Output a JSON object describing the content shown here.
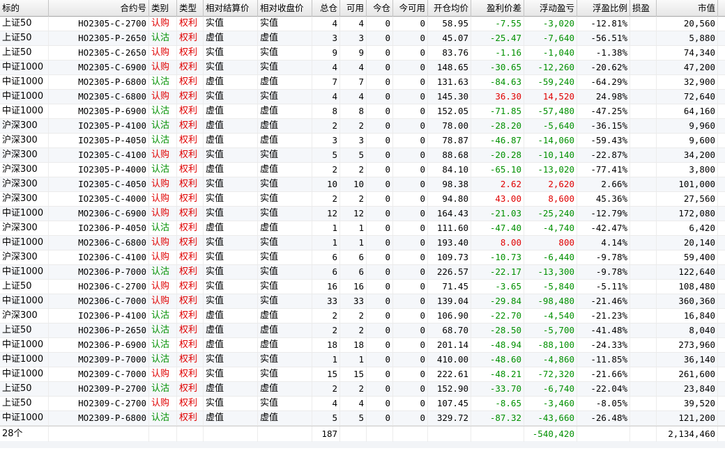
{
  "columns": [
    {
      "key": "underlying",
      "label": "标的",
      "w": 70,
      "align": "l"
    },
    {
      "key": "contract",
      "label": "合约号",
      "w": 144,
      "align": "r"
    },
    {
      "key": "category",
      "label": "类别",
      "w": 40,
      "align": "l"
    },
    {
      "key": "type",
      "label": "类型",
      "w": 38,
      "align": "l"
    },
    {
      "key": "settle",
      "label": "相对结算价",
      "w": 78,
      "align": "l"
    },
    {
      "key": "close",
      "label": "相对收盘价",
      "w": 78,
      "align": "l"
    },
    {
      "key": "total",
      "label": "总仓",
      "w": 40,
      "align": "r"
    },
    {
      "key": "avail",
      "label": "可用",
      "w": 38,
      "align": "r"
    },
    {
      "key": "today",
      "label": "今仓",
      "w": 38,
      "align": "r"
    },
    {
      "key": "today_avail",
      "label": "今可用",
      "w": 50,
      "align": "r"
    },
    {
      "key": "open_avg",
      "label": "开仓均价",
      "w": 62,
      "align": "r"
    },
    {
      "key": "pnl_diff",
      "label": "盈利价差",
      "w": 76,
      "align": "r"
    },
    {
      "key": "float_pnl",
      "label": "浮动盈亏",
      "w": 76,
      "align": "r"
    },
    {
      "key": "float_ratio",
      "label": "浮盈比例",
      "w": 76,
      "align": "r"
    },
    {
      "key": "stop",
      "label": "损盈",
      "w": 38,
      "align": "l"
    },
    {
      "key": "market_value",
      "label": "市值",
      "w": 88,
      "align": "r"
    }
  ],
  "colors": {
    "loss": "#009000",
    "profit": "#e00000",
    "call": "#e00000",
    "put": "#009000",
    "type": "#e00000"
  },
  "rows": [
    {
      "underlying": "上证50",
      "contract": "HO2305-C-2700",
      "category": "认购",
      "type": "权利",
      "settle": "实值",
      "close": "实值",
      "total": "4",
      "avail": "4",
      "today": "0",
      "today_avail": "0",
      "open_avg": "58.95",
      "pnl_diff": "-7.55",
      "float_pnl": "-3,020",
      "float_ratio": "-12.81%",
      "stop": "",
      "market_value": "20,560"
    },
    {
      "underlying": "上证50",
      "contract": "HO2305-P-2650",
      "category": "认沽",
      "type": "权利",
      "settle": "虚值",
      "close": "虚值",
      "total": "3",
      "avail": "3",
      "today": "0",
      "today_avail": "0",
      "open_avg": "45.07",
      "pnl_diff": "-25.47",
      "float_pnl": "-7,640",
      "float_ratio": "-56.51%",
      "stop": "",
      "market_value": "5,880"
    },
    {
      "underlying": "上证50",
      "contract": "HO2305-C-2650",
      "category": "认购",
      "type": "权利",
      "settle": "实值",
      "close": "实值",
      "total": "9",
      "avail": "9",
      "today": "0",
      "today_avail": "0",
      "open_avg": "83.76",
      "pnl_diff": "-1.16",
      "float_pnl": "-1,040",
      "float_ratio": "-1.38%",
      "stop": "",
      "market_value": "74,340"
    },
    {
      "underlying": "中证1000",
      "contract": "MO2305-C-6900",
      "category": "认购",
      "type": "权利",
      "settle": "实值",
      "close": "实值",
      "total": "4",
      "avail": "4",
      "today": "0",
      "today_avail": "0",
      "open_avg": "148.65",
      "pnl_diff": "-30.65",
      "float_pnl": "-12,260",
      "float_ratio": "-20.62%",
      "stop": "",
      "market_value": "47,200"
    },
    {
      "underlying": "中证1000",
      "contract": "MO2305-P-6800",
      "category": "认沽",
      "type": "权利",
      "settle": "虚值",
      "close": "虚值",
      "total": "7",
      "avail": "7",
      "today": "0",
      "today_avail": "0",
      "open_avg": "131.63",
      "pnl_diff": "-84.63",
      "float_pnl": "-59,240",
      "float_ratio": "-64.29%",
      "stop": "",
      "market_value": "32,900"
    },
    {
      "underlying": "中证1000",
      "contract": "MO2305-C-6800",
      "category": "认购",
      "type": "权利",
      "settle": "实值",
      "close": "实值",
      "total": "4",
      "avail": "4",
      "today": "0",
      "today_avail": "0",
      "open_avg": "145.30",
      "pnl_diff": "36.30",
      "float_pnl": "14,520",
      "float_ratio": "24.98%",
      "stop": "",
      "market_value": "72,640"
    },
    {
      "underlying": "中证1000",
      "contract": "MO2305-P-6900",
      "category": "认沽",
      "type": "权利",
      "settle": "虚值",
      "close": "虚值",
      "total": "8",
      "avail": "8",
      "today": "0",
      "today_avail": "0",
      "open_avg": "152.05",
      "pnl_diff": "-71.85",
      "float_pnl": "-57,480",
      "float_ratio": "-47.25%",
      "stop": "",
      "market_value": "64,160"
    },
    {
      "underlying": "沪深300",
      "contract": "IO2305-P-4100",
      "category": "认沽",
      "type": "权利",
      "settle": "虚值",
      "close": "虚值",
      "total": "2",
      "avail": "2",
      "today": "0",
      "today_avail": "0",
      "open_avg": "78.00",
      "pnl_diff": "-28.20",
      "float_pnl": "-5,640",
      "float_ratio": "-36.15%",
      "stop": "",
      "market_value": "9,960"
    },
    {
      "underlying": "沪深300",
      "contract": "IO2305-P-4050",
      "category": "认沽",
      "type": "权利",
      "settle": "虚值",
      "close": "虚值",
      "total": "3",
      "avail": "3",
      "today": "0",
      "today_avail": "0",
      "open_avg": "78.87",
      "pnl_diff": "-46.87",
      "float_pnl": "-14,060",
      "float_ratio": "-59.43%",
      "stop": "",
      "market_value": "9,600"
    },
    {
      "underlying": "沪深300",
      "contract": "IO2305-C-4100",
      "category": "认购",
      "type": "权利",
      "settle": "实值",
      "close": "实值",
      "total": "5",
      "avail": "5",
      "today": "0",
      "today_avail": "0",
      "open_avg": "88.68",
      "pnl_diff": "-20.28",
      "float_pnl": "-10,140",
      "float_ratio": "-22.87%",
      "stop": "",
      "market_value": "34,200"
    },
    {
      "underlying": "沪深300",
      "contract": "IO2305-P-4000",
      "category": "认沽",
      "type": "权利",
      "settle": "虚值",
      "close": "虚值",
      "total": "2",
      "avail": "2",
      "today": "0",
      "today_avail": "0",
      "open_avg": "84.10",
      "pnl_diff": "-65.10",
      "float_pnl": "-13,020",
      "float_ratio": "-77.41%",
      "stop": "",
      "market_value": "3,800"
    },
    {
      "underlying": "沪深300",
      "contract": "IO2305-C-4050",
      "category": "认购",
      "type": "权利",
      "settle": "实值",
      "close": "实值",
      "total": "10",
      "avail": "10",
      "today": "0",
      "today_avail": "0",
      "open_avg": "98.38",
      "pnl_diff": "2.62",
      "float_pnl": "2,620",
      "float_ratio": "2.66%",
      "stop": "",
      "market_value": "101,000"
    },
    {
      "underlying": "沪深300",
      "contract": "IO2305-C-4000",
      "category": "认购",
      "type": "权利",
      "settle": "实值",
      "close": "实值",
      "total": "2",
      "avail": "2",
      "today": "0",
      "today_avail": "0",
      "open_avg": "94.80",
      "pnl_diff": "43.00",
      "float_pnl": "8,600",
      "float_ratio": "45.36%",
      "stop": "",
      "market_value": "27,560"
    },
    {
      "underlying": "中证1000",
      "contract": "MO2306-C-6900",
      "category": "认购",
      "type": "权利",
      "settle": "实值",
      "close": "实值",
      "total": "12",
      "avail": "12",
      "today": "0",
      "today_avail": "0",
      "open_avg": "164.43",
      "pnl_diff": "-21.03",
      "float_pnl": "-25,240",
      "float_ratio": "-12.79%",
      "stop": "",
      "market_value": "172,080"
    },
    {
      "underlying": "沪深300",
      "contract": "IO2306-P-4050",
      "category": "认沽",
      "type": "权利",
      "settle": "虚值",
      "close": "虚值",
      "total": "1",
      "avail": "1",
      "today": "0",
      "today_avail": "0",
      "open_avg": "111.60",
      "pnl_diff": "-47.40",
      "float_pnl": "-4,740",
      "float_ratio": "-42.47%",
      "stop": "",
      "market_value": "6,420"
    },
    {
      "underlying": "中证1000",
      "contract": "MO2306-C-6800",
      "category": "认购",
      "type": "权利",
      "settle": "实值",
      "close": "实值",
      "total": "1",
      "avail": "1",
      "today": "0",
      "today_avail": "0",
      "open_avg": "193.40",
      "pnl_diff": "8.00",
      "float_pnl": "800",
      "float_ratio": "4.14%",
      "stop": "",
      "market_value": "20,140"
    },
    {
      "underlying": "沪深300",
      "contract": "IO2306-C-4100",
      "category": "认购",
      "type": "权利",
      "settle": "实值",
      "close": "实值",
      "total": "6",
      "avail": "6",
      "today": "0",
      "today_avail": "0",
      "open_avg": "109.73",
      "pnl_diff": "-10.73",
      "float_pnl": "-6,440",
      "float_ratio": "-9.78%",
      "stop": "",
      "market_value": "59,400"
    },
    {
      "underlying": "中证1000",
      "contract": "MO2306-P-7000",
      "category": "认沽",
      "type": "权利",
      "settle": "实值",
      "close": "实值",
      "total": "6",
      "avail": "6",
      "today": "0",
      "today_avail": "0",
      "open_avg": "226.57",
      "pnl_diff": "-22.17",
      "float_pnl": "-13,300",
      "float_ratio": "-9.78%",
      "stop": "",
      "market_value": "122,640"
    },
    {
      "underlying": "上证50",
      "contract": "HO2306-C-2700",
      "category": "认购",
      "type": "权利",
      "settle": "实值",
      "close": "实值",
      "total": "16",
      "avail": "16",
      "today": "0",
      "today_avail": "0",
      "open_avg": "71.45",
      "pnl_diff": "-3.65",
      "float_pnl": "-5,840",
      "float_ratio": "-5.11%",
      "stop": "",
      "market_value": "108,480"
    },
    {
      "underlying": "中证1000",
      "contract": "MO2306-C-7000",
      "category": "认购",
      "type": "权利",
      "settle": "实值",
      "close": "实值",
      "total": "33",
      "avail": "33",
      "today": "0",
      "today_avail": "0",
      "open_avg": "139.04",
      "pnl_diff": "-29.84",
      "float_pnl": "-98,480",
      "float_ratio": "-21.46%",
      "stop": "",
      "market_value": "360,360"
    },
    {
      "underlying": "沪深300",
      "contract": "IO2306-P-4100",
      "category": "认沽",
      "type": "权利",
      "settle": "虚值",
      "close": "虚值",
      "total": "2",
      "avail": "2",
      "today": "0",
      "today_avail": "0",
      "open_avg": "106.90",
      "pnl_diff": "-22.70",
      "float_pnl": "-4,540",
      "float_ratio": "-21.23%",
      "stop": "",
      "market_value": "16,840"
    },
    {
      "underlying": "上证50",
      "contract": "HO2306-P-2650",
      "category": "认沽",
      "type": "权利",
      "settle": "虚值",
      "close": "虚值",
      "total": "2",
      "avail": "2",
      "today": "0",
      "today_avail": "0",
      "open_avg": "68.70",
      "pnl_diff": "-28.50",
      "float_pnl": "-5,700",
      "float_ratio": "-41.48%",
      "stop": "",
      "market_value": "8,040"
    },
    {
      "underlying": "中证1000",
      "contract": "MO2306-P-6900",
      "category": "认沽",
      "type": "权利",
      "settle": "虚值",
      "close": "虚值",
      "total": "18",
      "avail": "18",
      "today": "0",
      "today_avail": "0",
      "open_avg": "201.14",
      "pnl_diff": "-48.94",
      "float_pnl": "-88,100",
      "float_ratio": "-24.33%",
      "stop": "",
      "market_value": "273,960"
    },
    {
      "underlying": "中证1000",
      "contract": "MO2309-P-7000",
      "category": "认沽",
      "type": "权利",
      "settle": "实值",
      "close": "实值",
      "total": "1",
      "avail": "1",
      "today": "0",
      "today_avail": "0",
      "open_avg": "410.00",
      "pnl_diff": "-48.60",
      "float_pnl": "-4,860",
      "float_ratio": "-11.85%",
      "stop": "",
      "market_value": "36,140"
    },
    {
      "underlying": "中证1000",
      "contract": "MO2309-C-7000",
      "category": "认购",
      "type": "权利",
      "settle": "实值",
      "close": "实值",
      "total": "15",
      "avail": "15",
      "today": "0",
      "today_avail": "0",
      "open_avg": "222.61",
      "pnl_diff": "-48.21",
      "float_pnl": "-72,320",
      "float_ratio": "-21.66%",
      "stop": "",
      "market_value": "261,600"
    },
    {
      "underlying": "上证50",
      "contract": "HO2309-P-2700",
      "category": "认沽",
      "type": "权利",
      "settle": "虚值",
      "close": "虚值",
      "total": "2",
      "avail": "2",
      "today": "0",
      "today_avail": "0",
      "open_avg": "152.90",
      "pnl_diff": "-33.70",
      "float_pnl": "-6,740",
      "float_ratio": "-22.04%",
      "stop": "",
      "market_value": "23,840"
    },
    {
      "underlying": "上证50",
      "contract": "HO2309-C-2700",
      "category": "认购",
      "type": "权利",
      "settle": "实值",
      "close": "实值",
      "total": "4",
      "avail": "4",
      "today": "0",
      "today_avail": "0",
      "open_avg": "107.45",
      "pnl_diff": "-8.65",
      "float_pnl": "-3,460",
      "float_ratio": "-8.05%",
      "stop": "",
      "market_value": "39,520"
    },
    {
      "underlying": "中证1000",
      "contract": "MO2309-P-6800",
      "category": "认沽",
      "type": "权利",
      "settle": "虚值",
      "close": "虚值",
      "total": "5",
      "avail": "5",
      "today": "0",
      "today_avail": "0",
      "open_avg": "329.72",
      "pnl_diff": "-87.32",
      "float_pnl": "-43,660",
      "float_ratio": "-26.48%",
      "stop": "",
      "market_value": "121,200"
    }
  ],
  "footer": {
    "underlying": "28个",
    "total": "187",
    "float_pnl": "-540,420",
    "market_value": "2,134,460"
  }
}
